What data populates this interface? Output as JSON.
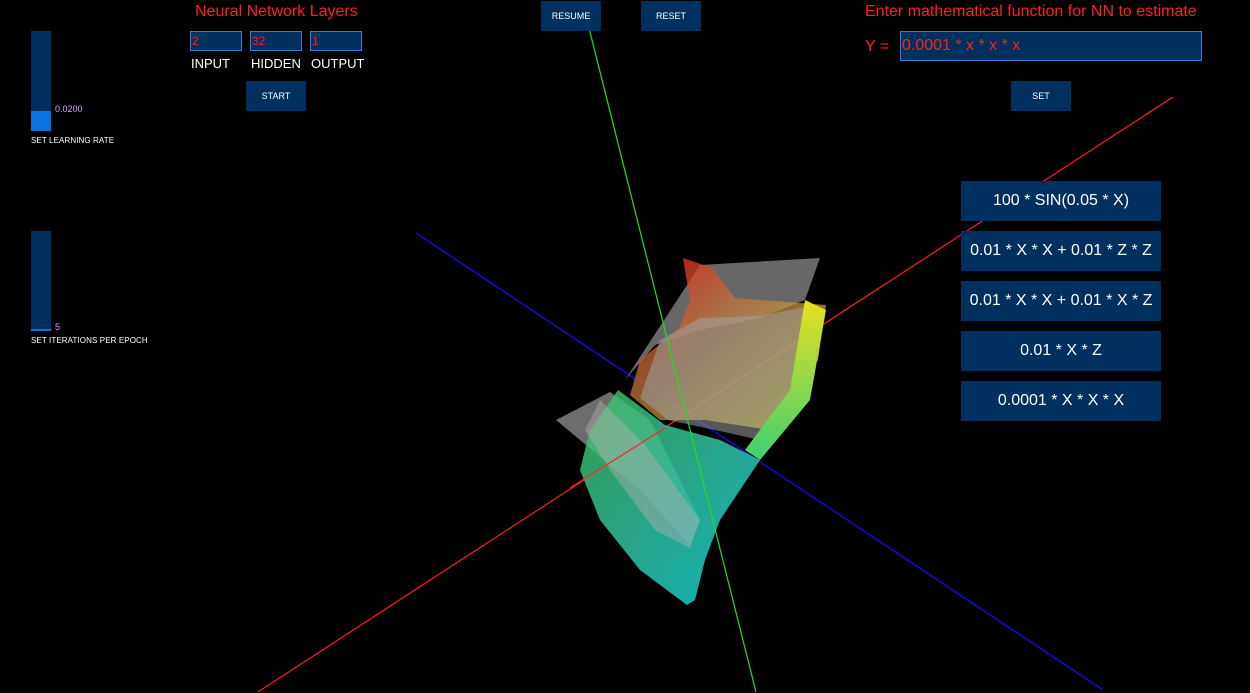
{
  "layers": {
    "title": "Neural Network Layers",
    "input_value": "2",
    "hidden_value": "32",
    "output_value": "1",
    "input_label": "INPUT",
    "hidden_label": "HIDDEN",
    "output_label": "OUTPUT",
    "start_label": "START"
  },
  "controls": {
    "resume_label": "RESUME",
    "reset_label": "RESET"
  },
  "learning_rate": {
    "value": "0.0200",
    "level": 0.2,
    "caption": "SET LEARNING RATE"
  },
  "iterations": {
    "value": "5",
    "level": 0.02,
    "caption": "SET ITERATIONS PER EPOCH"
  },
  "function_panel": {
    "title": "Enter mathematical function for NN to estimate",
    "y_label": "Y =",
    "input_value": "0.0001 * x * x * x",
    "set_label": "SET",
    "presets": [
      "100 * SIN(0.05 * X)",
      "0.01 * X * X + 0.01 * Z * Z",
      "0.01 * X * X + 0.01 * X * Z",
      "0.01 * X * Z",
      "0.0001 * X * X * X"
    ]
  },
  "axis_colors": {
    "x_axis": "#ff2020",
    "y_axis": "#22dd22",
    "z_axis": "#1010ff"
  }
}
